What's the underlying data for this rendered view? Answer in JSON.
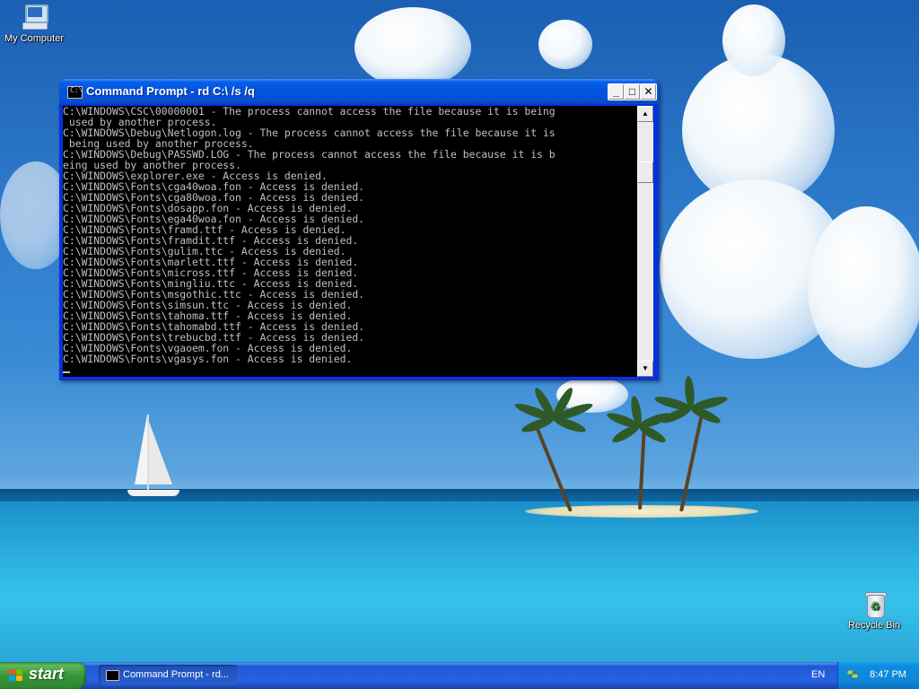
{
  "desktop": {
    "icons": {
      "my_computer": "My Computer",
      "recycle_bin": "Recycle Bin"
    }
  },
  "window": {
    "title": "Command Prompt - rd C:\\ /s /q",
    "icon_glyph": "C:\\",
    "buttons": {
      "minimize": "_",
      "maximize": "□",
      "close": "✕"
    },
    "console_lines": [
      "C:\\WINDOWS\\CSC\\00000001 - The process cannot access the file because it is being",
      " used by another process.",
      "C:\\WINDOWS\\Debug\\Netlogon.log - The process cannot access the file because it is",
      " being used by another process.",
      "C:\\WINDOWS\\Debug\\PASSWD.LOG - The process cannot access the file because it is b",
      "eing used by another process.",
      "C:\\WINDOWS\\explorer.exe - Access is denied.",
      "C:\\WINDOWS\\Fonts\\cga40woa.fon - Access is denied.",
      "C:\\WINDOWS\\Fonts\\cga80woa.fon - Access is denied.",
      "C:\\WINDOWS\\Fonts\\dosapp.fon - Access is denied.",
      "C:\\WINDOWS\\Fonts\\ega40woa.fon - Access is denied.",
      "C:\\WINDOWS\\Fonts\\framd.ttf - Access is denied.",
      "C:\\WINDOWS\\Fonts\\framdit.ttf - Access is denied.",
      "C:\\WINDOWS\\Fonts\\gulim.ttc - Access is denied.",
      "C:\\WINDOWS\\Fonts\\marlett.ttf - Access is denied.",
      "C:\\WINDOWS\\Fonts\\micross.ttf - Access is denied.",
      "C:\\WINDOWS\\Fonts\\mingliu.ttc - Access is denied.",
      "C:\\WINDOWS\\Fonts\\msgothic.ttc - Access is denied.",
      "C:\\WINDOWS\\Fonts\\simsun.ttc - Access is denied.",
      "C:\\WINDOWS\\Fonts\\tahoma.ttf - Access is denied.",
      "C:\\WINDOWS\\Fonts\\tahomabd.ttf - Access is denied.",
      "C:\\WINDOWS\\Fonts\\trebucbd.ttf - Access is denied.",
      "C:\\WINDOWS\\Fonts\\vgaoem.fon - Access is denied.",
      "C:\\WINDOWS\\Fonts\\vgasys.fon - Access is denied."
    ]
  },
  "taskbar": {
    "start_label": "start",
    "task_label": "Command Prompt - rd...",
    "language": "EN",
    "clock": "8:47 PM"
  },
  "colors": {
    "console_bg": "#000000",
    "console_text": "#c0c0c0",
    "titlebar": "#0a50d6",
    "taskbar": "#2663e0",
    "start_button": "#379537"
  }
}
